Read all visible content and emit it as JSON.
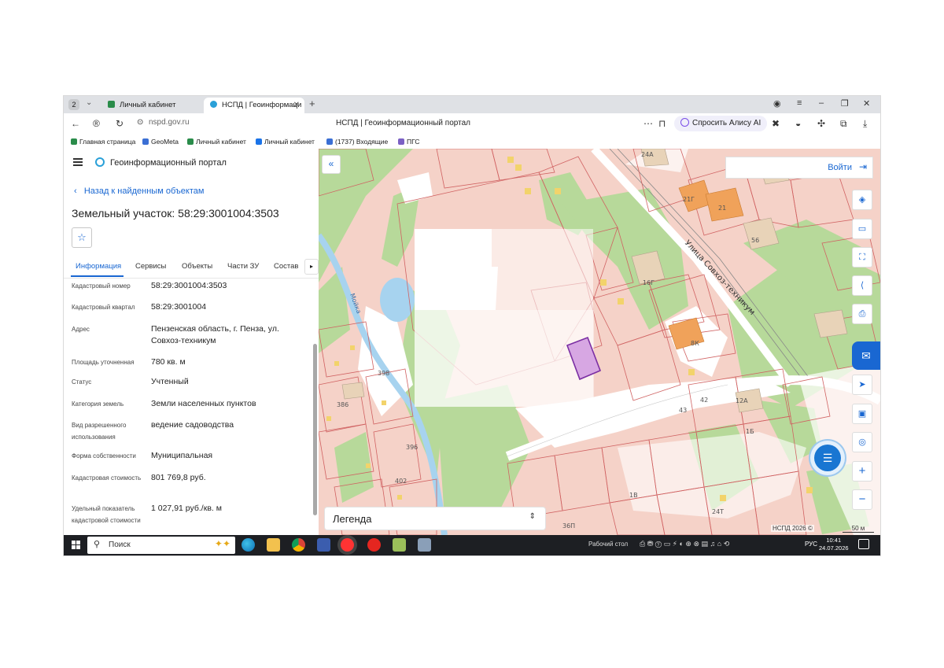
{
  "browser": {
    "tab_count": "2",
    "tabs": [
      {
        "label": "Личный кабинет",
        "color": "#2a8c4a"
      },
      {
        "label": "НСПД | Геоинформаци",
        "color": "#2aa0d8"
      }
    ],
    "url": "nspd.gov.ru",
    "page_title": "НСПД | Геоинформационный портал",
    "alice_label": "Спросить Алису AI",
    "bookmarks": [
      {
        "label": "Главная страница",
        "color": "#2a8c4a"
      },
      {
        "label": "GeoMeta",
        "color": "#3b6fd4"
      },
      {
        "label": "Личный кабинет",
        "color": "#2a8c4a"
      },
      {
        "label": "Личный кабинет",
        "color": "#1a73e8"
      },
      {
        "label": "(1737) Входящие",
        "color": "#3b6fd4"
      },
      {
        "label": "ПГС",
        "color": "#7b61c4"
      }
    ]
  },
  "panel": {
    "brand": "Геоинформационный портал",
    "back_link": "Назад к найденным объектам",
    "title": "Земельный участок: 58:29:3001004:3503",
    "tabs": [
      "Информация",
      "Сервисы",
      "Объекты",
      "Части ЗУ",
      "Состав"
    ],
    "active_tab": "Информация",
    "rows": [
      {
        "key": "Кадастровый номер",
        "value": "58:29:3001004:3503"
      },
      {
        "key": "Кадастровый квартал",
        "value": "58:29:3001004"
      },
      {
        "key": "Адрес",
        "value": "Пензенская область, г. Пенза, ул. Совхоз-техникум"
      },
      {
        "key": "Площадь уточненная",
        "value": "780 кв. м"
      },
      {
        "key": "Статус",
        "value": "Учтенный"
      },
      {
        "key": "Категория земель",
        "value": "Земли населенных пунктов"
      },
      {
        "key": "Вид разрешенного использования",
        "value": "ведение садоводства"
      },
      {
        "key": "Форма собственности",
        "value": "Муниципальная"
      },
      {
        "key": "Кадастровая стоимость",
        "value": "801 769,8 руб."
      },
      {
        "key": "Удельный показатель кадастровой стоимости",
        "value": "1 027,91 руб./кв. м"
      }
    ]
  },
  "map": {
    "login_label": "Войти",
    "legend_label": "Легенда",
    "attribution": "НСПД 2026 ©",
    "scale_label": "50 м",
    "street_label": "Улица Совхоз-техникум",
    "river_label": "Мойка",
    "parcel_labels": [
      "24А",
      "21Г",
      "21",
      "56",
      "16Г",
      "8К",
      "42",
      "12А",
      "43",
      "1Б",
      "398",
      "386",
      "396",
      "402",
      "1В",
      "24Т",
      "36П"
    ],
    "colors": {
      "green": "#b7d99a",
      "pink": "#f5d2c8",
      "selected": "#7b2fa3",
      "water": "#a7d3ef"
    }
  },
  "taskbar": {
    "search_label": "Поиск",
    "desktop_label": "Рабочий стол",
    "lang": "РУС",
    "time": "10:41",
    "date": "24.07.2026"
  }
}
